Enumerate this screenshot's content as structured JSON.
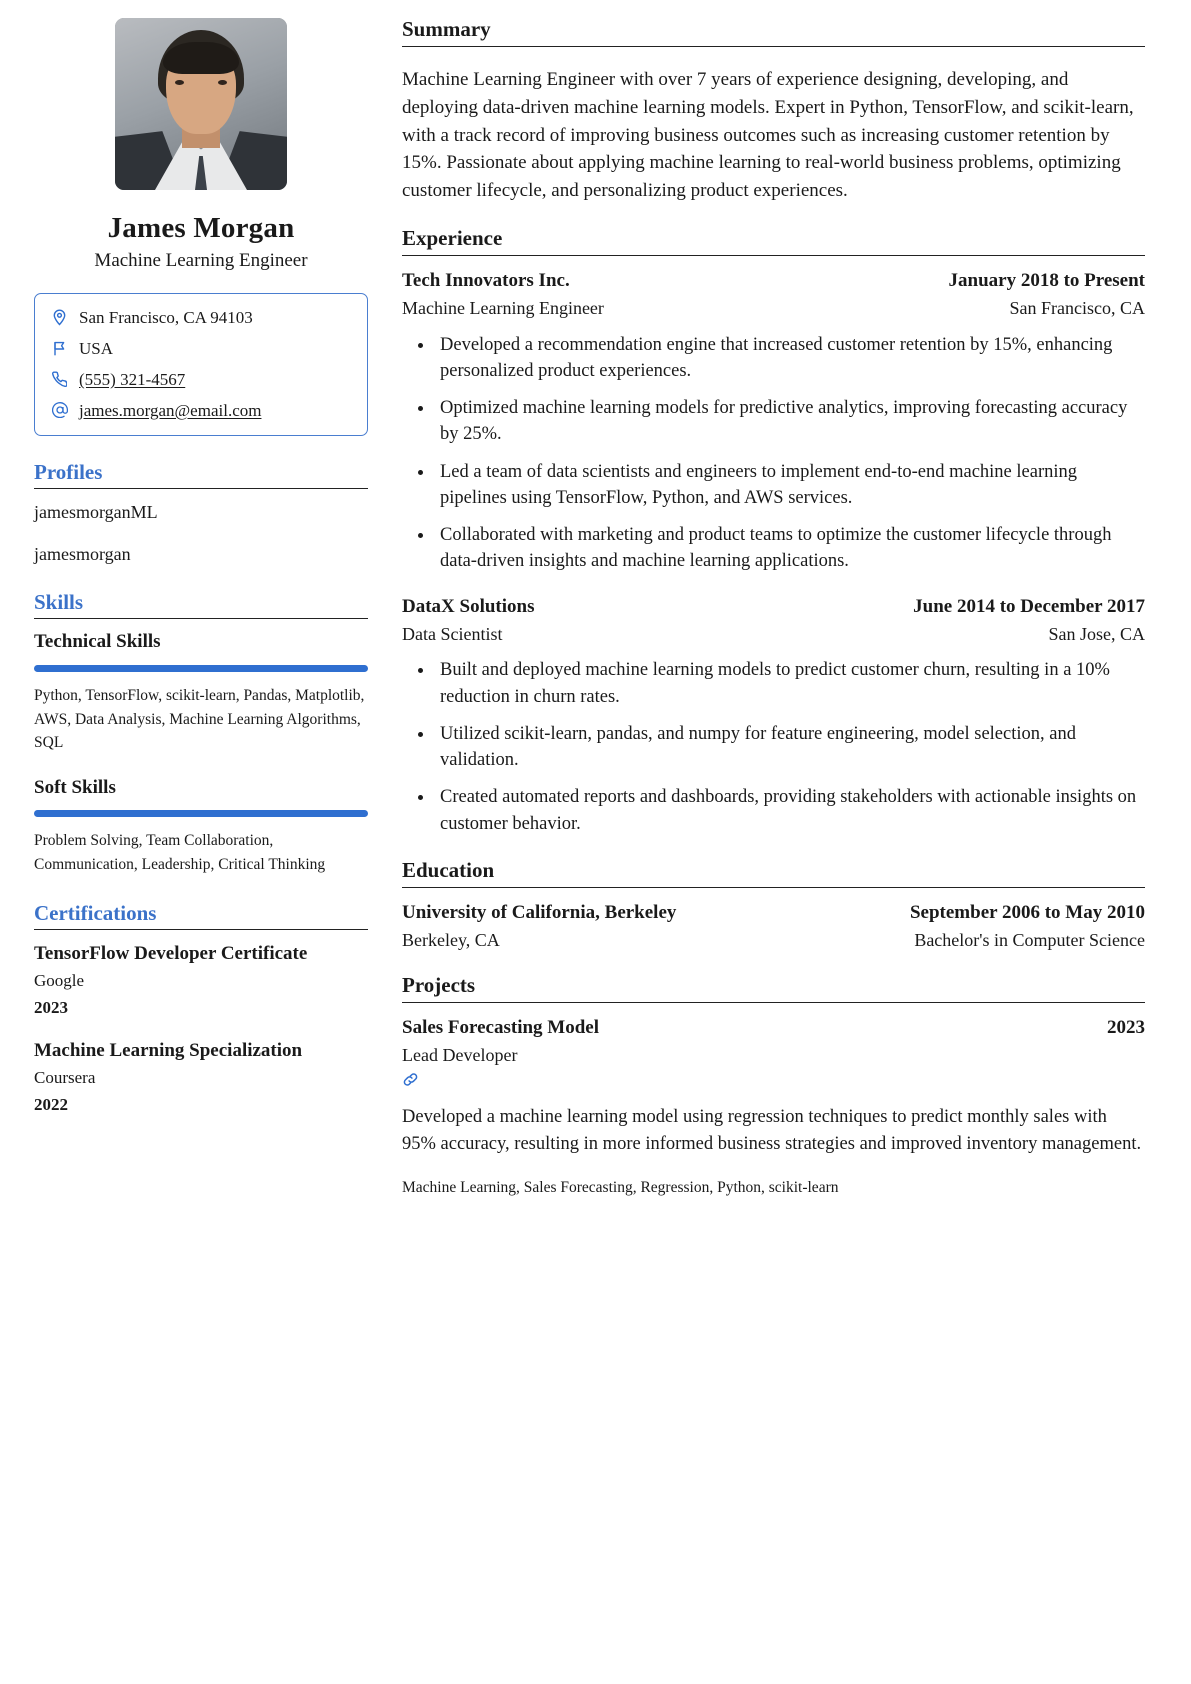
{
  "profile": {
    "avatar_alt": "portrait-photo",
    "full_name": "James Morgan",
    "headline": "Machine Learning Engineer"
  },
  "contact": {
    "items": [
      {
        "icon": "location-pin-icon",
        "text": "San Francisco, CA 94103",
        "link": false
      },
      {
        "icon": "flag-icon",
        "text": "USA",
        "link": false
      },
      {
        "icon": "phone-icon",
        "text": "(555) 321-4567",
        "link": true
      },
      {
        "icon": "at-sign-icon",
        "text": "james.morgan@email.com",
        "link": true
      }
    ]
  },
  "profiles": {
    "heading": "Profiles",
    "items": [
      {
        "username": "jamesmorganML"
      },
      {
        "username": "jamesmorgan"
      }
    ]
  },
  "skills": {
    "heading": "Skills",
    "groups": [
      {
        "name": "Technical Skills",
        "level_percent": 100,
        "keywords": "Python, TensorFlow, scikit-learn, Pandas, Matplotlib, AWS, Data Analysis, Machine Learning Algorithms, SQL"
      },
      {
        "name": "Soft Skills",
        "level_percent": 100,
        "keywords": "Problem Solving, Team Collaboration, Communication, Leadership, Critical Thinking"
      }
    ]
  },
  "certifications": {
    "heading": "Certifications",
    "items": [
      {
        "name": "TensorFlow Developer Certificate",
        "issuer": "Google",
        "date": "2023"
      },
      {
        "name": "Machine Learning Specialization",
        "issuer": "Coursera",
        "date": "2022"
      }
    ]
  },
  "summary": {
    "heading": "Summary",
    "text": "Machine Learning Engineer with over 7 years of experience designing, developing, and deploying data-driven machine learning models. Expert in Python, TensorFlow, and scikit-learn, with a track record of improving business outcomes such as increasing customer retention by 15%. Passionate about applying machine learning to real-world business problems, optimizing customer lifecycle, and personalizing product experiences."
  },
  "experience": {
    "heading": "Experience",
    "items": [
      {
        "company": "Tech Innovators Inc.",
        "date": "January 2018 to Present",
        "position": "Machine Learning Engineer",
        "location": "San Francisco, CA",
        "bullets": [
          "Developed a recommendation engine that increased customer retention by 15%, enhancing personalized product experiences.",
          "Optimized machine learning models for predictive analytics, improving forecasting accuracy by 25%.",
          "Led a team of data scientists and engineers to implement end-to-end machine learning pipelines using TensorFlow, Python, and AWS services.",
          "Collaborated with marketing and product teams to optimize the customer lifecycle through data-driven insights and machine learning applications."
        ]
      },
      {
        "company": "DataX Solutions",
        "date": "June 2014 to December 2017",
        "position": "Data Scientist",
        "location": "San Jose, CA",
        "bullets": [
          "Built and deployed machine learning models to predict customer churn, resulting in a 10% reduction in churn rates.",
          "Utilized scikit-learn, pandas, and numpy for feature engineering, model selection, and validation.",
          "Created automated reports and dashboards, providing stakeholders with actionable insights on customer behavior."
        ]
      }
    ]
  },
  "education": {
    "heading": "Education",
    "items": [
      {
        "institution": "University of California, Berkeley",
        "date": "September 2006 to May 2010",
        "location": "Berkeley, CA",
        "degree": "Bachelor's in Computer Science"
      }
    ]
  },
  "projects": {
    "heading": "Projects",
    "items": [
      {
        "name": "Sales Forecasting Model",
        "date": "2023",
        "role": "Lead Developer",
        "link_icon": "link-chain-icon",
        "description": "Developed a machine learning model using regression techniques to predict monthly sales with 95% accuracy, resulting in more informed business strategies and improved inventory management.",
        "tags": "Machine Learning, Sales Forecasting, Regression, Python, scikit-learn"
      }
    ]
  },
  "theme": {
    "accent": "#2f6fd0",
    "heading_blue": "#3b72c9",
    "text": "#1a1a1a",
    "rule": "#222222"
  }
}
